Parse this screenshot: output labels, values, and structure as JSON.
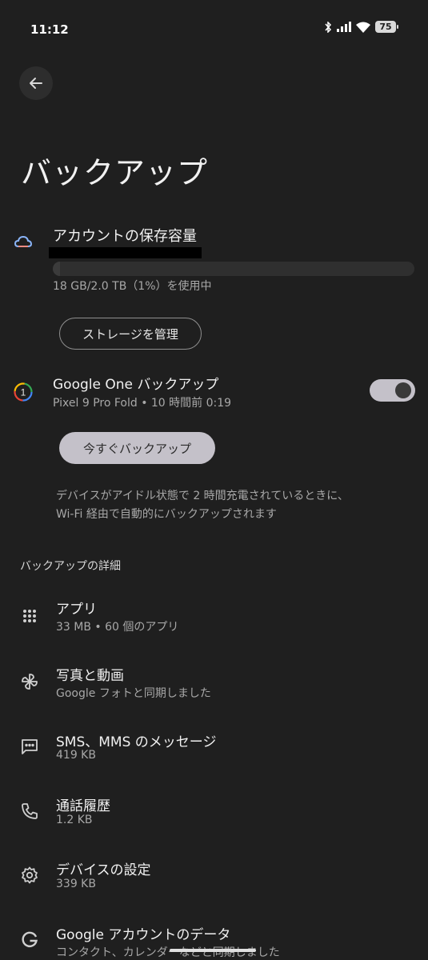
{
  "status_bar": {
    "time": "11:12",
    "battery": "75",
    "icons": [
      "bluetooth-icon",
      "signal-icon",
      "wifi-icon",
      "battery-icon"
    ]
  },
  "header": {
    "back_icon": "arrow-back-icon",
    "title": "バックアップ"
  },
  "storage": {
    "icon": "cloud-icon",
    "title": "アカウントの保存容量",
    "usage_text": "18 GB/2.0 TB（1%）を使用中",
    "used_fraction": 0.01,
    "manage_button": "ストレージを管理"
  },
  "google_one": {
    "icon": "google-one-icon",
    "title": "Google One バックアップ",
    "subtitle": "Pixel 9 Pro Fold • 10 時間前 0:19",
    "toggle_on": true,
    "backup_now_button": "今すぐバックアップ",
    "info_line1": "デバイスがアイドル状態で 2 時間充電されているときに、",
    "info_line2": "Wi-Fi 経由で自動的にバックアップされます"
  },
  "details": {
    "header": "バックアップの詳細",
    "items": [
      {
        "icon": "apps-grid-icon",
        "title": "アプリ",
        "subtitle": "33 MB • 60 個のアプリ"
      },
      {
        "icon": "pinwheel-icon",
        "title": "写真と動画",
        "subtitle": "Google フォトと同期しました"
      },
      {
        "icon": "message-icon",
        "title": "SMS、MMS のメッセージ",
        "subtitle": "419 KB"
      },
      {
        "icon": "phone-icon",
        "title": "通話履歴",
        "subtitle": "1.2 KB"
      },
      {
        "icon": "gear-icon",
        "title": "デバイスの設定",
        "subtitle": "339 KB"
      },
      {
        "icon": "google-g-icon",
        "title": "Google アカウントのデータ",
        "subtitle": "コンタクト、カレンダーなどと同期しました"
      }
    ]
  },
  "colors": {
    "background": "#1f1f1f",
    "accent_button": "#c4c1c9",
    "text_secondary": "#a8a8a8"
  }
}
